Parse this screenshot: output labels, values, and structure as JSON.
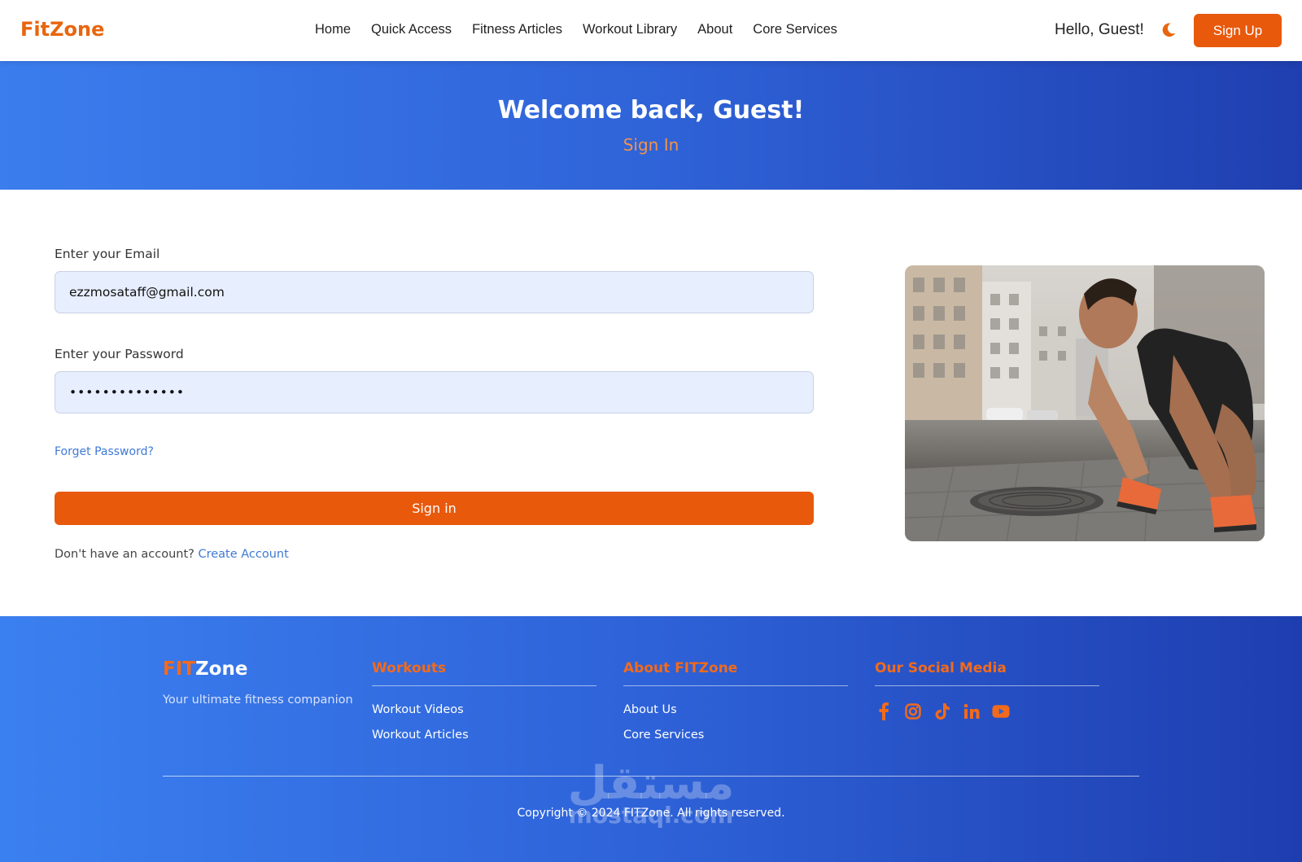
{
  "navbar": {
    "brand": "FitZone",
    "links": [
      "Home",
      "Quick Access",
      "Fitness Articles",
      "Workout Library",
      "About",
      "Core Services"
    ],
    "greeting": "Hello, Guest!",
    "theme_icon": "moon-icon",
    "signup_label": "Sign Up"
  },
  "hero": {
    "title": "Welcome back, Guest!",
    "subtitle": "Sign In"
  },
  "form": {
    "email_label": "Enter your Email",
    "email_value": "ezzmosataff@gmail.com",
    "password_label": "Enter your Password",
    "password_value": "••••••••••••••",
    "forgot_label": "Forget Password?",
    "signin_label": "Sign in",
    "no_account_text": "Don't have an account?",
    "create_account_label": "Create Account"
  },
  "footer": {
    "brand_accent": "FIT",
    "brand_rest": "Zone",
    "tagline": "Your ultimate fitness companion",
    "columns": [
      {
        "title": "Workouts",
        "links": [
          "Workout Videos",
          "Workout Articles"
        ]
      },
      {
        "title": "About FITZone",
        "links": [
          "About Us",
          "Core Services"
        ]
      },
      {
        "title": "Our Social Media",
        "icons": [
          "facebook-icon",
          "instagram-icon",
          "tiktok-icon",
          "linkedin-icon",
          "youtube-icon"
        ]
      }
    ],
    "copyright": "Copyright © 2024 FITZone. All rights reserved.",
    "watermark_arabic": "مستقل",
    "watermark_latin": "mostaql.com"
  },
  "colors": {
    "accent": "#e8590c",
    "hero_gradient_start": "#3b7ded",
    "hero_gradient_end": "#1f3fb0",
    "link": "#3f7ad6"
  }
}
